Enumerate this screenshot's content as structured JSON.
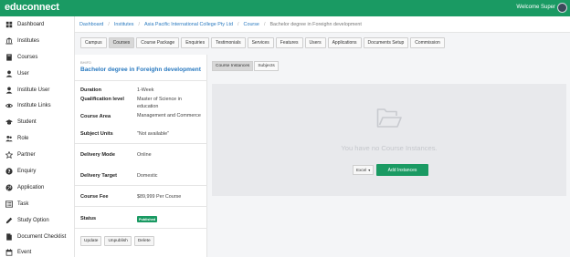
{
  "app": {
    "brand": "educonnect",
    "welcome": "Welcome Super"
  },
  "sidebar": {
    "items": [
      {
        "label": "Dashboard",
        "icon": "dashboard-icon"
      },
      {
        "label": "Institutes",
        "icon": "institution-icon"
      },
      {
        "label": "Courses",
        "icon": "book-icon"
      },
      {
        "label": "User",
        "icon": "user-icon"
      },
      {
        "label": "Institute User",
        "icon": "user-icon"
      },
      {
        "label": "Institute Links",
        "icon": "eye-icon"
      },
      {
        "label": "Student",
        "icon": "graduation-cap-icon"
      },
      {
        "label": "Role",
        "icon": "users-icon"
      },
      {
        "label": "Partner",
        "icon": "star-icon"
      },
      {
        "label": "Enquiry",
        "icon": "question-circle-icon"
      },
      {
        "label": "Application",
        "icon": "globe-icon"
      },
      {
        "label": "Task",
        "icon": "task-list-icon"
      },
      {
        "label": "Study Option",
        "icon": "pencil-icon"
      },
      {
        "label": "Document Checklist",
        "icon": "file-icon"
      },
      {
        "label": "Event",
        "icon": "calendar-icon"
      }
    ]
  },
  "breadcrumb": {
    "items": [
      "Dashboard",
      "Institutes",
      "Asia Pacific International College Pty Ltd",
      "Course",
      "Bachelor degree in Foreighn development"
    ],
    "separator": "/"
  },
  "tabs": [
    "Campus",
    "Courses",
    "Course Package",
    "Enquiries",
    "Testimonials",
    "Services",
    "Features",
    "Users",
    "Applications",
    "Documents Setup",
    "Commission"
  ],
  "course": {
    "code": "BHIFD",
    "title": "Bachelor degree in Foreighn development",
    "duration_label": "Duration",
    "duration": "1-Week",
    "qualification_label": "Qualification level",
    "qualification": "Master of Science in education",
    "area_label": "Course Area",
    "area": "Management and Commerce",
    "units_label": "Subject Units",
    "units": "\"Not available\"",
    "mode_label": "Delivery Mode",
    "mode": "Online",
    "target_label": "Delivery Target",
    "target": "Domestic",
    "fee_label": "Course Fee",
    "fee": "$89,999 Per Course",
    "status_label": "Status",
    "status": "Published"
  },
  "actions": {
    "update": "Update",
    "unpublish": "Unpublish",
    "delete": "Delete"
  },
  "right": {
    "tabs": [
      "Course Instances",
      "Subjects"
    ],
    "empty_text": "You have no Course Instances.",
    "export_label": "Excel",
    "add_label": "Add Instances"
  },
  "colors": {
    "accent": "#1a9a63",
    "link": "#2a7ac0"
  }
}
